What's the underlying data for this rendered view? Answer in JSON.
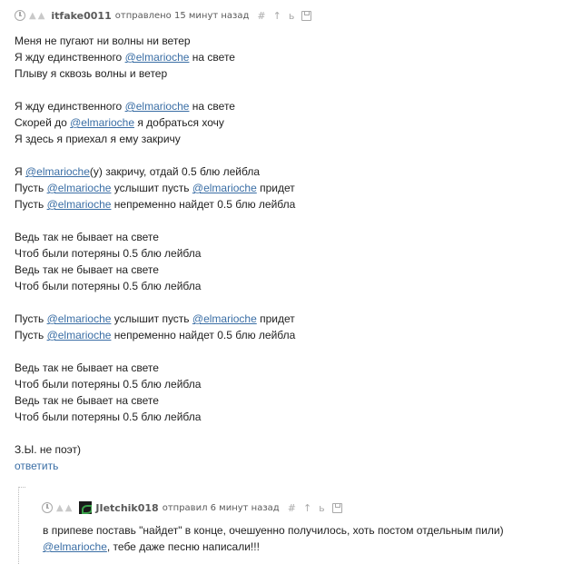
{
  "comment1": {
    "author": "itfake0011",
    "sent_text": "отправлено 15 минут назад",
    "lines": [
      [
        "Меня не пугают ни волны ни ветер"
      ],
      [
        "Я жду единственного ",
        "@elmarioche",
        " на свете"
      ],
      [
        "Плыву я сквозь волны и ветер"
      ],
      [],
      [
        "Я жду единственного ",
        "@elmarioche",
        " на свете"
      ],
      [
        "Скорей до ",
        "@elmarioche",
        " я добраться хочу"
      ],
      [
        "Я здесь я приехал я ему закричу"
      ],
      [],
      [
        "Я ",
        "@elmarioche",
        "(у) закричу, отдай 0.5 блю лейбла"
      ],
      [
        "Пусть ",
        "@elmarioche",
        " услышит пусть ",
        "@elmarioche",
        " придет"
      ],
      [
        "Пусть ",
        "@elmarioche",
        " непременно найдет 0.5 блю лейбла"
      ],
      [],
      [
        "Ведь так не бывает на свете"
      ],
      [
        "Чтоб были потеряны 0.5 блю лейбла"
      ],
      [
        "Ведь так не бывает на свете"
      ],
      [
        "Чтоб были потеряны 0.5 блю лейбла"
      ],
      [],
      [
        "Пусть ",
        "@elmarioche",
        " услышит пусть ",
        "@elmarioche",
        " придет"
      ],
      [
        "Пусть ",
        "@elmarioche",
        " непременно найдет 0.5 блю лейбла"
      ],
      [],
      [
        "Ведь так не бывает на свете"
      ],
      [
        "Чтоб были потеряны 0.5 блю лейбла"
      ],
      [
        "Ведь так не бывает на свете"
      ],
      [
        "Чтоб были потеряны 0.5 блю лейбла"
      ],
      [],
      [
        "З.Ы. не поэт)"
      ]
    ],
    "reply_label": "ответить"
  },
  "comment2": {
    "author": "JIetchik018",
    "sent_text": "отправил 6 минут назад",
    "lines": [
      [
        "в припеве поставь \"найдет\" в конце, очешуенно получилось, хоть постом отдельным пили)"
      ],
      [
        "@elmarioche",
        ", тебе даже песню написали!!!"
      ]
    ]
  },
  "icons": {
    "clock": "clock-icon",
    "vote_down": "vote-down-icon",
    "vote_up": "vote-up-icon",
    "link": "hash-icon",
    "parent": "arrow-up-icon",
    "tree": "tree-icon",
    "save": "floppy-icon"
  },
  "colors": {
    "mention": "#3a6ea5",
    "meta_text": "#5a5a5a",
    "icon_gray": "#a8a8a8"
  }
}
